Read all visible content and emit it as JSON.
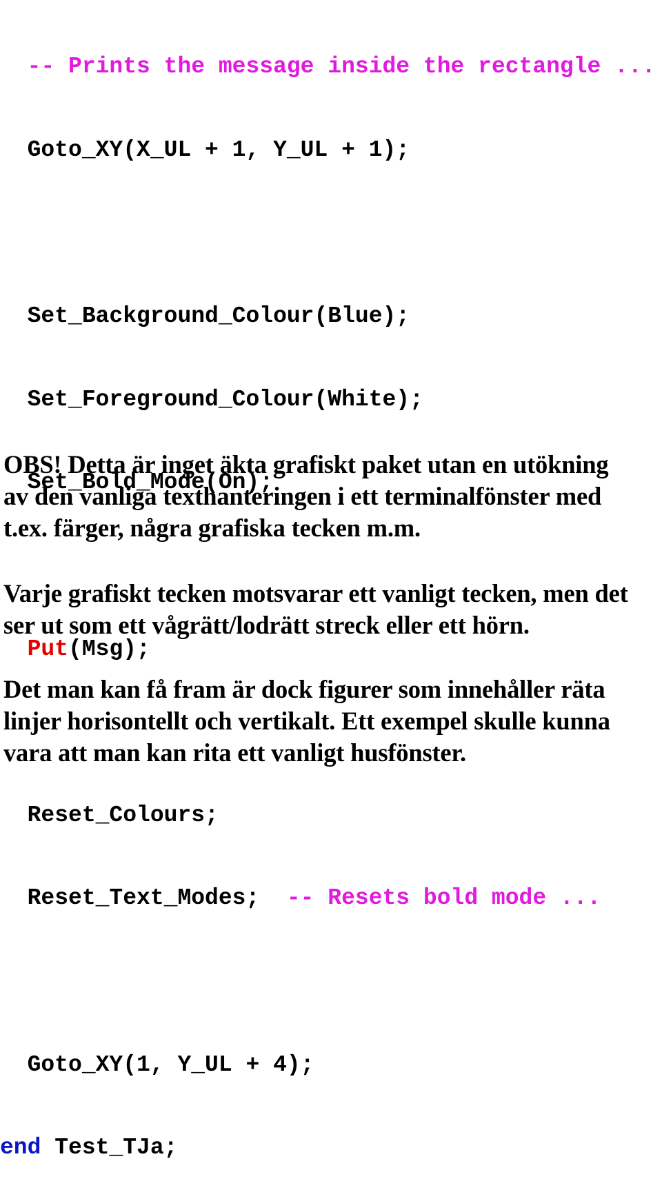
{
  "code": {
    "lines": [
      {
        "indent": "  ",
        "comment": "-- Prints the message inside the rectangle ..."
      },
      {
        "indent": "  ",
        "text": "Goto_XY(X_UL + 1, Y_UL + 1);"
      },
      {
        "indent": "",
        "text": ""
      },
      {
        "indent": "  ",
        "text": "Set_Background_Colour(Blue);"
      },
      {
        "indent": "  ",
        "text": "Set_Foreground_Colour(White);"
      },
      {
        "indent": "  ",
        "text": "Set_Bold_Mode(On);"
      },
      {
        "indent": "",
        "text": ""
      },
      {
        "indent": "  ",
        "keyword": "Put",
        "text": "(Msg);"
      },
      {
        "indent": "",
        "text": ""
      },
      {
        "indent": "  ",
        "text": "Reset_Colours;"
      },
      {
        "indent": "  ",
        "text": "Reset_Text_Modes;",
        "gap": "  ",
        "comment": "-- Resets bold mode ..."
      },
      {
        "indent": "",
        "text": ""
      },
      {
        "indent": "  ",
        "text": "Goto_XY(1, Y_UL + 4);"
      },
      {
        "indent": "",
        "keyword": "end",
        "text": " Test_TJa;"
      }
    ],
    "colors": {
      "comment": "#e21ae0",
      "keyword_put": "#e00000",
      "keyword_end": "#0b16c8",
      "text": "#000000"
    }
  },
  "paragraphs": [
    {
      "lines": [
        "OBS! Detta är inget äkta grafiskt paket utan en utökning",
        "av den vanliga texthanteringen i ett terminalfönster med",
        "t.ex. färger, några grafiska tecken m.m."
      ]
    },
    {
      "lines": [
        "Varje grafiskt tecken motsvarar ett vanligt tecken, men det",
        "ser ut som ett vågrätt/lodrätt streck eller ett hörn."
      ]
    },
    {
      "lines": [
        "Det man kan få fram är dock figurer som innehåller räta",
        "linjer horisontellt och vertikalt. Ett exempel skulle kunna",
        "vara att man kan rita ett vanligt husfönster."
      ]
    }
  ]
}
